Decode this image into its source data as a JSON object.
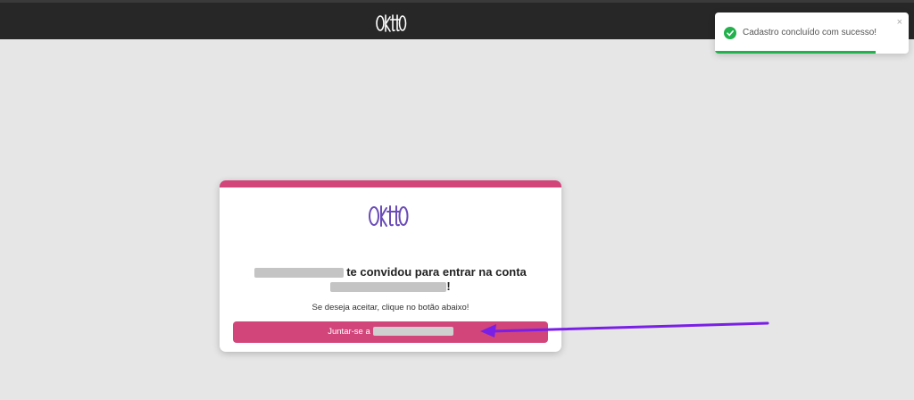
{
  "header": {
    "logo_icon": "okto-logo-icon"
  },
  "toast": {
    "message": "Cadastro concluído com sucesso!",
    "close_label": "×",
    "status_color": "#22b14c",
    "progress": 0.83
  },
  "invite_card": {
    "logo_icon": "okto-logo-icon",
    "accent_color": "#d2457a",
    "headline_text": "te convidou para entrar na conta",
    "headline_suffix": "!",
    "subtitle": "Se deseja aceitar, clique no botão abaixo!",
    "join_button_label": "Juntar-se a"
  },
  "annotation": {
    "arrow_color": "#7a1fe6"
  }
}
